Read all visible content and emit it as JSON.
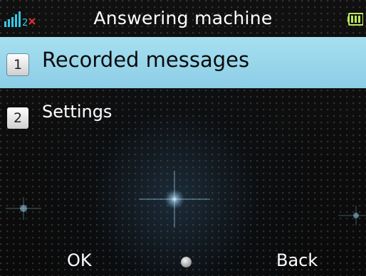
{
  "status_bar": {
    "title": "Answering machine",
    "signal_icon": "signal-strength-icon",
    "line_label": "2",
    "no_service_icon": "red-x-icon",
    "battery_icon": "battery-icon"
  },
  "menu": {
    "items": [
      {
        "number": "1",
        "label": "Recorded messages",
        "selected": true
      },
      {
        "number": "2",
        "label": "Settings",
        "selected": false
      }
    ]
  },
  "softkeys": {
    "left": "OK",
    "center_icon": "navigation-dot-icon",
    "right": "Back"
  },
  "colors": {
    "selection": "#9cd7ec",
    "background": "#0b0b0b",
    "text": "#ffffff",
    "signal": "#36c7e6",
    "no_service": "#e03030",
    "battery": "#b9e85a"
  }
}
